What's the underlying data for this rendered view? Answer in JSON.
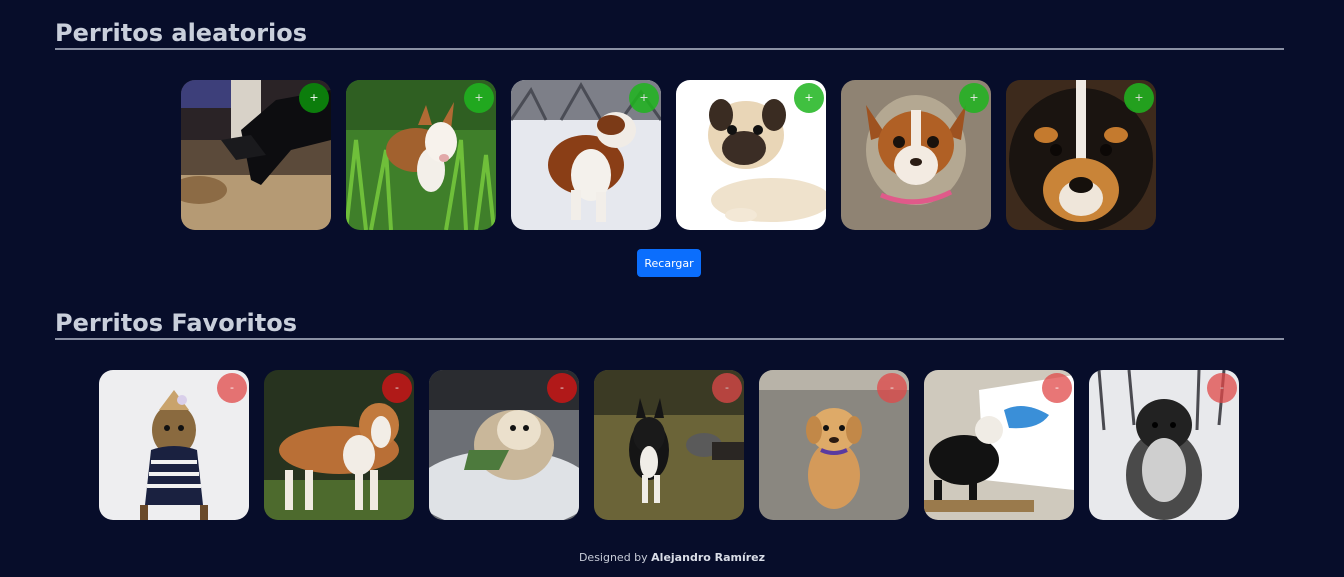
{
  "random_section": {
    "title": "Perritos aleatorios",
    "cards": [
      {
        "photo": "dog-photo-legs",
        "button_label": "+"
      },
      {
        "photo": "dog-photo-bullterrier-grass",
        "button_label": "+"
      },
      {
        "photo": "dog-photo-saint-bernard-snow",
        "button_label": "+"
      },
      {
        "photo": "dog-photo-pug",
        "button_label": "+"
      },
      {
        "photo": "dog-photo-chihuahua",
        "button_label": "+"
      },
      {
        "photo": "dog-photo-puppy-closeup",
        "button_label": "+"
      }
    ],
    "reload_label": "Recargar"
  },
  "favorites_section": {
    "title": "Perritos Favoritos",
    "cards": [
      {
        "photo": "dog-photo-yorkie",
        "button_label": "-"
      },
      {
        "photo": "dog-photo-boxer",
        "button_label": "-"
      },
      {
        "photo": "dog-photo-shihtzu-snow",
        "button_label": "-"
      },
      {
        "photo": "dog-photo-boston-terrier",
        "button_label": "-"
      },
      {
        "photo": "dog-photo-golden-puppy",
        "button_label": "-"
      },
      {
        "photo": "dog-photo-painting-dog",
        "button_label": "-"
      },
      {
        "photo": "dog-photo-poodle-snow",
        "button_label": "-"
      }
    ]
  },
  "footer": {
    "prefix": "Designed by",
    "author": "Alejandro Ramírez"
  },
  "colors": {
    "background": "#070d2a",
    "add_button": "#1fb51f",
    "remove_button": "#e04848",
    "reload_button": "#0b6efd"
  }
}
